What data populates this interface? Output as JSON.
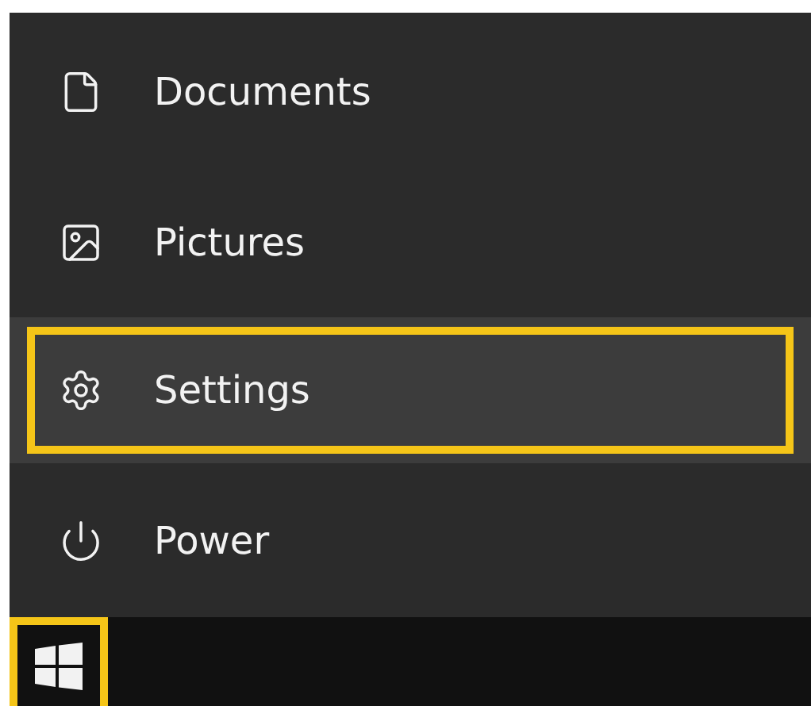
{
  "menu": {
    "items": [
      {
        "kind": "document",
        "label": "Documents",
        "selected": false,
        "highlighted": false
      },
      {
        "kind": "picture",
        "label": "Pictures",
        "selected": false,
        "highlighted": false
      },
      {
        "kind": "settings",
        "label": "Settings",
        "selected": true,
        "highlighted": true
      },
      {
        "kind": "power",
        "label": "Power",
        "selected": false,
        "highlighted": false
      }
    ]
  },
  "taskbar": {
    "start_button": {
      "highlighted": true
    }
  }
}
